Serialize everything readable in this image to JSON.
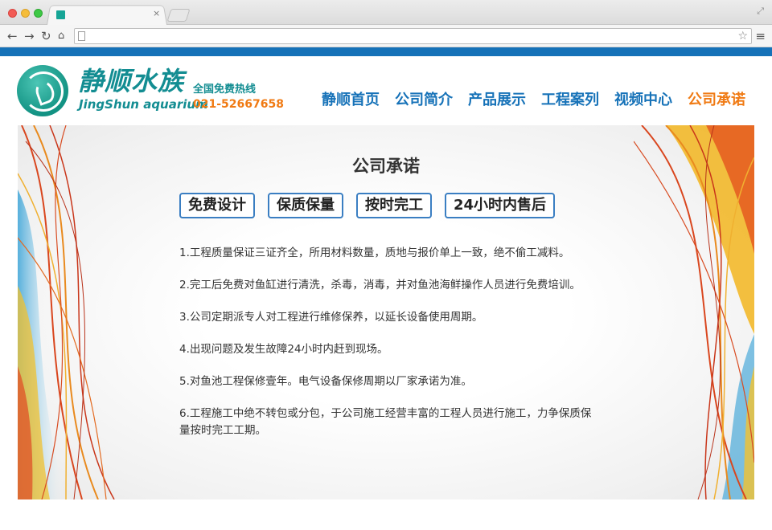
{
  "browser": {
    "tab_close": "×",
    "icons": [
      "back-icon",
      "forward-icon",
      "reload-icon",
      "home-icon",
      "page-icon",
      "star-icon",
      "menu-icon",
      "resize-icon"
    ]
  },
  "header": {
    "logo_cn": "静顺水族",
    "logo_en": "JingShun aquarium",
    "hotline_label": "全国免费热线",
    "hotline_number": "021-52667658"
  },
  "nav": {
    "items": [
      {
        "label": "静顺首页"
      },
      {
        "label": "公司简介"
      },
      {
        "label": "产品展示"
      },
      {
        "label": "工程案列"
      },
      {
        "label": "视频中心"
      },
      {
        "label": "公司承诺"
      }
    ],
    "active_index": 5
  },
  "main": {
    "title": "公司承诺",
    "badges": [
      "免费设计",
      "保质保量",
      "按时完工",
      "24小时内售后"
    ],
    "promises": [
      "1.工程质量保证三证齐全，所用材料数量，质地与报价单上一致，绝不偷工减料。",
      "2.完工后免费对鱼缸进行清洗，杀毒，消毒，并对鱼池海鲜操作人员进行免费培训。",
      "3.公司定期派专人对工程进行维修保养，以延长设备使用周期。",
      "4.出现问题及发生故障24小时内赶到现场。",
      "5.对鱼池工程保修壹年。电气设备保修周期以厂家承诺为准。",
      "6.工程施工中绝不转包或分包，于公司施工经营丰富的工程人员进行施工，力争保质保量按时完工工期。"
    ]
  },
  "colors": {
    "brand_teal": "#138d92",
    "nav_blue": "#1672b8",
    "accent_orange": "#f07a13"
  }
}
